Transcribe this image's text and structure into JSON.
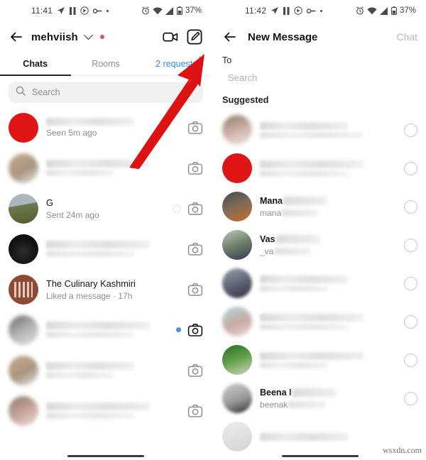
{
  "meta": {
    "watermark": "wsxdn.com"
  },
  "left_phone": {
    "status_bar": {
      "time": "11:41",
      "battery": "37%",
      "icons": [
        "navigation-icon",
        "pause-icon",
        "record-icon",
        "link-icon",
        "dot-icon",
        "alarm-icon",
        "wifi-icon",
        "signal-icon",
        "battery-icon"
      ]
    },
    "header": {
      "back": "back-arrow-icon",
      "username": "mehviish",
      "chevron": "chevron-down-icon",
      "status_dot": "red-dot",
      "video_call": "video-camera-icon",
      "compose": "compose-pencil-icon"
    },
    "tabs": [
      {
        "label": "Chats",
        "active": true
      },
      {
        "label": "Rooms",
        "active": false
      },
      {
        "label": "2 requests",
        "active": false,
        "highlight": true
      }
    ],
    "search": {
      "placeholder": "Search",
      "icon": "search-icon"
    },
    "chats": [
      {
        "name": "",
        "sub": "Seen 5m ago",
        "blurred_name": true,
        "avatar": "av-red",
        "unread": false,
        "pending": false
      },
      {
        "name": "",
        "sub": "",
        "blurred_name": true,
        "avatar": "av-blur1",
        "unread": false,
        "pending": false
      },
      {
        "name": "G",
        "sub": "Sent 24m ago",
        "blurred_name": false,
        "avatar": "av-g",
        "unread": false,
        "pending": true
      },
      {
        "name": "",
        "sub": "",
        "blurred_name": true,
        "avatar": "av-build",
        "unread": false,
        "pending": false
      },
      {
        "name": "The Culinary Kashmiri",
        "sub": "Liked a message · 17h",
        "blurred_name": false,
        "avatar": "av-culinary",
        "unread": false,
        "pending": false
      },
      {
        "name": "",
        "sub": "",
        "blurred_name": true,
        "avatar": "av-blur1",
        "unread": true,
        "pending": false
      },
      {
        "name": "",
        "sub": "",
        "blurred_name": true,
        "avatar": "av-blur2",
        "unread": false,
        "pending": false
      },
      {
        "name": "",
        "sub": "",
        "blurred_name": true,
        "avatar": "av-blur3",
        "unread": false,
        "pending": false
      }
    ],
    "camera_icon": "camera-icon",
    "annotation": {
      "type": "red-arrow",
      "points_to": "compose-pencil-icon",
      "color": "#DD1313"
    }
  },
  "right_phone": {
    "status_bar": {
      "time": "11:42",
      "battery": "37%"
    },
    "header": {
      "back": "back-arrow-icon",
      "title": "New Message",
      "action": "Chat"
    },
    "to_label": "To",
    "to_search_placeholder": "Search",
    "suggested_label": "Suggested",
    "suggested": [
      {
        "name": "",
        "username": "",
        "blurred": "full",
        "avatar": "sg-av1"
      },
      {
        "name": "",
        "username": "",
        "blurred": "full",
        "avatar": "sg-av2"
      },
      {
        "name": "Mana",
        "username": "mana",
        "blurred": "partial",
        "avatar": "sg-av3"
      },
      {
        "name": "Vas",
        "username": "_va",
        "blurred": "partial",
        "avatar": "sg-av4"
      },
      {
        "name": "",
        "username": "",
        "blurred": "full",
        "avatar": "sg-av5"
      },
      {
        "name": "",
        "username": "",
        "blurred": "full",
        "avatar": "sg-av6"
      },
      {
        "name": "",
        "username": "",
        "blurred": "full",
        "avatar": "sg-av7"
      },
      {
        "name": "Beena I",
        "username": "beenak",
        "blurred": "partial",
        "avatar": "sg-av8"
      },
      {
        "name": "",
        "username": "",
        "blurred": "full",
        "avatar": "sg-av9"
      }
    ],
    "select_circle": "radio-circle-icon"
  },
  "colors": {
    "accent_red": "#E01616",
    "unread_blue": "#3897f0",
    "link_blue": "#2b8ef0",
    "arrow_red": "#DD1313"
  }
}
